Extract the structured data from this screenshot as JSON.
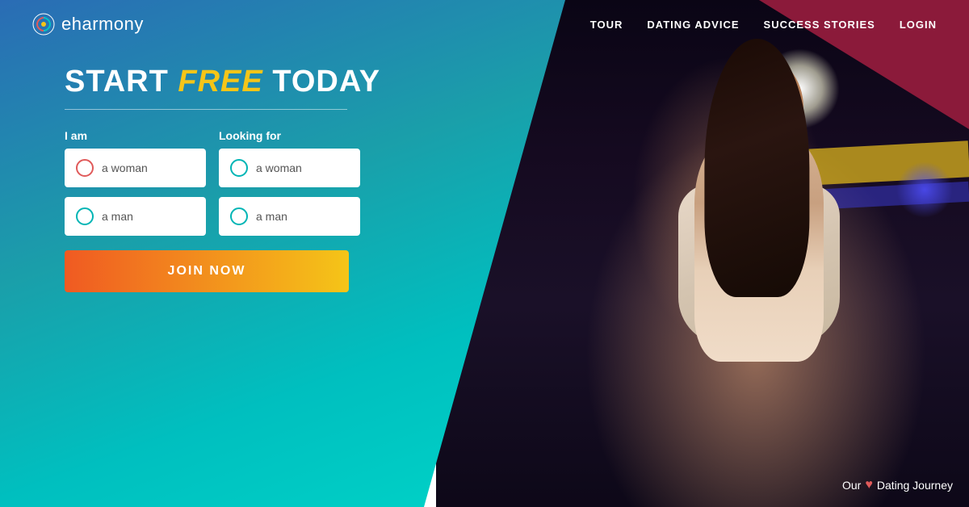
{
  "page": {
    "title": "eharmony - START free TODAY"
  },
  "header": {
    "logo_text": "eharmony",
    "nav": {
      "tour_label": "TOUR",
      "dating_advice_label": "DATING ADVICE",
      "success_stories_label": "SUCCESS STORIES",
      "login_label": "LOGIN"
    }
  },
  "hero": {
    "headline_start": "START ",
    "headline_free": "free",
    "headline_end": " TODAY"
  },
  "form": {
    "i_am_label": "I am",
    "looking_for_label": "Looking for",
    "i_am_options": [
      {
        "id": "iam-woman",
        "label": "a woman",
        "color": "red"
      },
      {
        "id": "iam-man",
        "label": "a man",
        "color": "teal"
      }
    ],
    "looking_for_options": [
      {
        "id": "lf-woman",
        "label": "a woman",
        "color": "teal"
      },
      {
        "id": "lf-man",
        "label": "a man",
        "color": "teal"
      }
    ],
    "join_button_label": "JOIN NOW"
  },
  "watermark": {
    "prefix": "Our",
    "suffix": "Dating Journey"
  }
}
